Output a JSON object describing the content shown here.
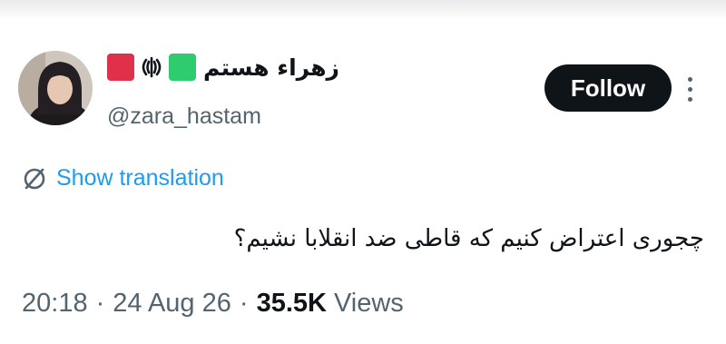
{
  "tweet": {
    "author": {
      "display_name": "زهراء هستم",
      "handle": "@zara_hastam",
      "avatar_icon": "profile-photo",
      "flags": {
        "red_square_color": "#e0314a",
        "green_square_color": "#2fcc6f",
        "emblem_icon": "iran-emblem-icon"
      }
    },
    "follow_label": "Follow",
    "more_icon": "more-vertical-icon",
    "translation": {
      "icon": "translate-icon",
      "label": "Show translation"
    },
    "text": "چجوری اعتراض کنیم که قاطی ضد انقلابا نشیم؟",
    "meta": {
      "time": "20:18",
      "separator": "·",
      "date": "24 Aug 26",
      "views_count": "35.5K",
      "views_label": "Views"
    }
  },
  "colors": {
    "accent_link": "#1d9bf0",
    "text_primary": "#0f1419",
    "text_secondary": "#536471"
  }
}
